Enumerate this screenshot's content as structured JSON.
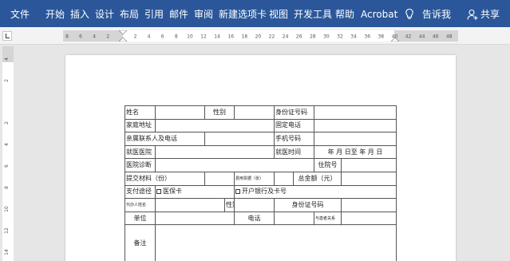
{
  "ribbon": {
    "tabs": [
      "文件",
      "开始",
      "插入",
      "设计",
      "布局",
      "引用",
      "邮件",
      "审阅",
      "新建选项卡",
      "视图",
      "开发工具",
      "帮助",
      "Acrobat"
    ],
    "tell_me": "告诉我",
    "share": "共享"
  },
  "ruler": {
    "h_labels": [
      "8",
      "6",
      "4",
      "2",
      "2",
      "4",
      "6",
      "8",
      "10",
      "12",
      "14",
      "16",
      "18",
      "20",
      "22",
      "24",
      "26",
      "28",
      "30",
      "32",
      "34",
      "36",
      "38",
      "40",
      "42",
      "44",
      "46",
      "48"
    ],
    "v_labels": [
      "4",
      "2",
      "2",
      "4",
      "6",
      "8",
      "10",
      "12",
      "14"
    ]
  },
  "form": {
    "row1": {
      "name": "姓名",
      "gender": "性别",
      "id": "身份证号码"
    },
    "row2": {
      "address": "家庭地址",
      "phone": "固定电话"
    },
    "row3": {
      "relative": "亲属联系人及电话",
      "mobile": "手机号码"
    },
    "row4": {
      "hospital": "就医医院",
      "time": "就医时间",
      "date_range": "年  月  日至  年  月  日"
    },
    "row5": {
      "diagnosis": "医院诊断",
      "inpatient_no": "住院号"
    },
    "row6": {
      "materials": "提交材料（份）",
      "receipt": "费用票据（张）",
      "total": "总金额（元）"
    },
    "row7": {
      "payment": "支付途径",
      "medical_card": "医保卡",
      "bank": "开户银行及卡号"
    },
    "row8": {
      "agent": "代办人姓名",
      "gender": "性别",
      "id": "身份证号码"
    },
    "row9": {
      "unit": "单位",
      "phone": "电话",
      "relation": "与患者关系"
    },
    "row10": {
      "remark": "备注"
    }
  }
}
